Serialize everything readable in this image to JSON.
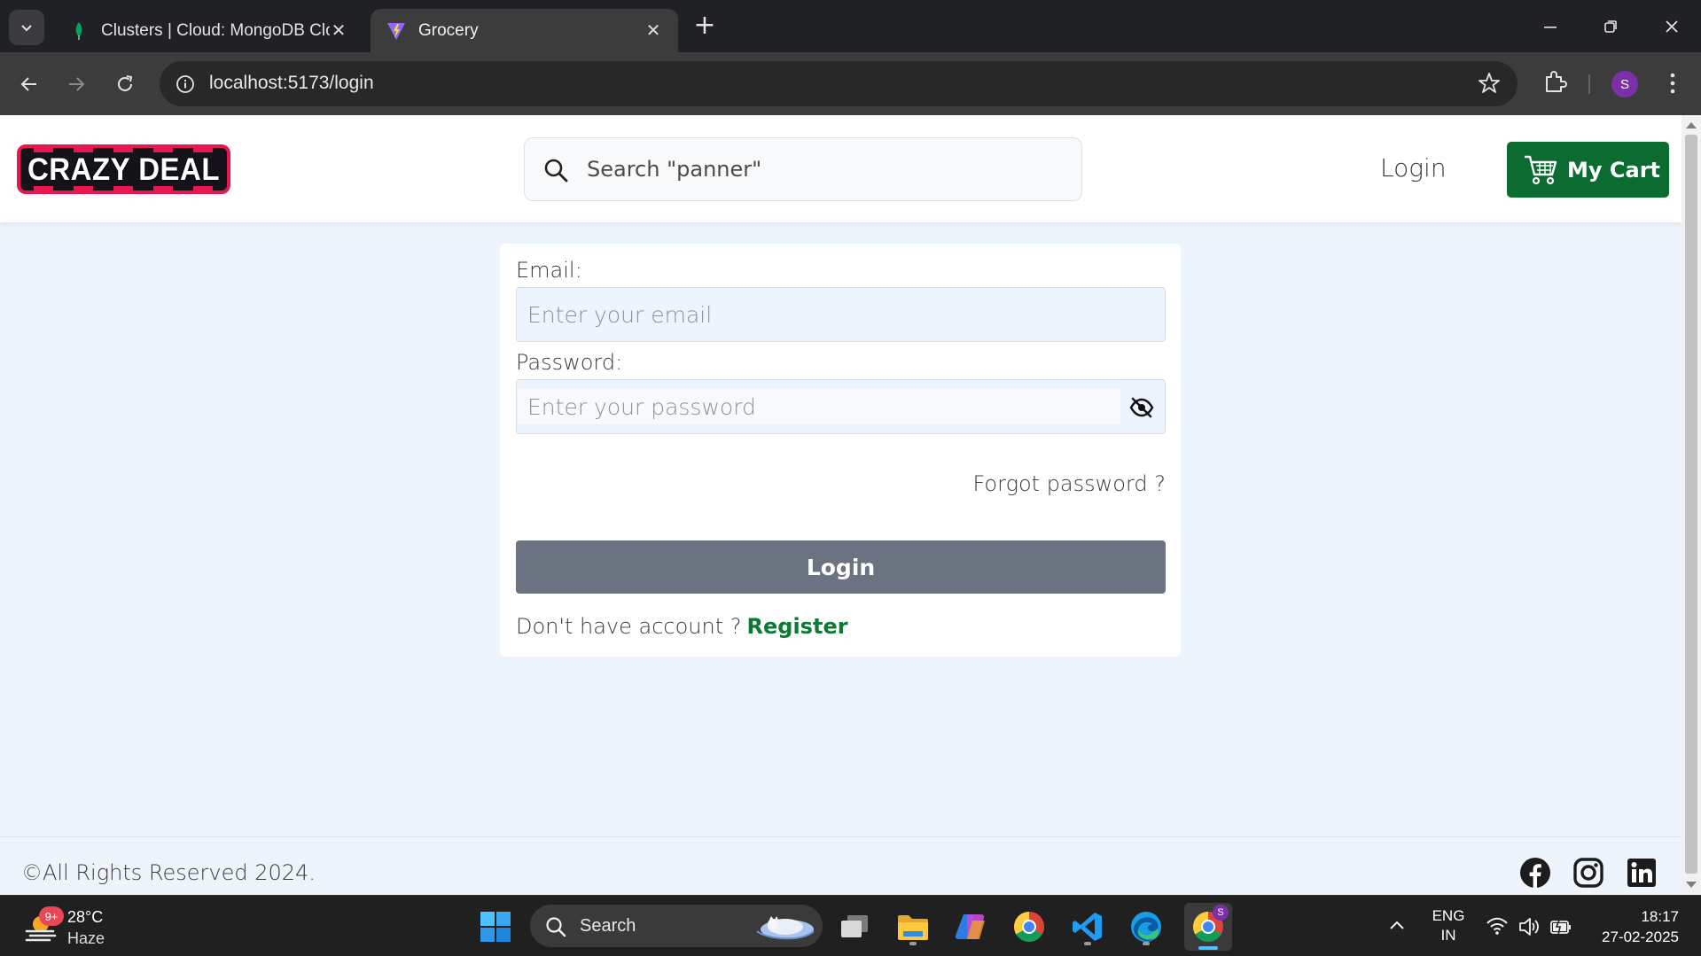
{
  "browser": {
    "tabs": [
      {
        "title": "Clusters | Cloud: MongoDB Clou",
        "active": false,
        "icon": "mongodb-leaf-icon"
      },
      {
        "title": "Grocery",
        "active": true,
        "icon": "vite-icon"
      }
    ],
    "new_tab_label": "+",
    "url": "localhost:5173/login",
    "profile_initial": "S"
  },
  "header": {
    "logo_text": "CRAZY DEAL",
    "search_placeholder": "Search \"panner\"",
    "login_label": "Login",
    "cart_label": "My Cart"
  },
  "login_form": {
    "email_label": "Email:",
    "email_placeholder": "Enter your email",
    "password_label": "Password:",
    "password_placeholder": "Enter your password",
    "forgot_label": "Forgot password ?",
    "submit_label": "Login",
    "no_account_text": "Don't have account ?",
    "register_label": "Register"
  },
  "footer": {
    "copyright": "©All Rights Reserved 2024.",
    "social": [
      "facebook-icon",
      "instagram-icon",
      "linkedin-icon"
    ]
  },
  "taskbar": {
    "weather_badge": "9+",
    "weather_temp": "28°C",
    "weather_condition": "Haze",
    "search_label": "Search",
    "language_line1": "ENG",
    "language_line2": "IN",
    "time": "18:17",
    "date": "27-02-2025",
    "chrome_profile_badge": "S"
  },
  "colors": {
    "brand_green": "#0b6b30",
    "register_green": "#0b7a35",
    "login_button": "#6b7280",
    "logo_border": "#e8174f",
    "page_background": "#eef4fb"
  }
}
